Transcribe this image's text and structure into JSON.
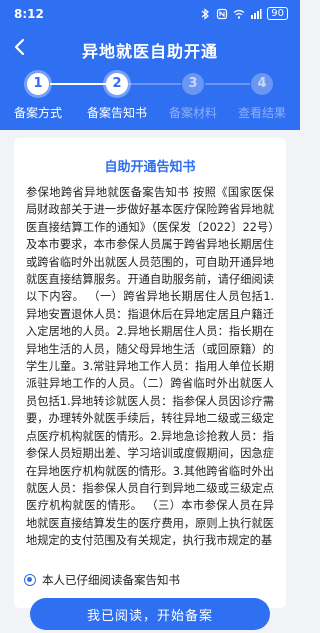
{
  "status": {
    "time": "8:12",
    "battery": "90"
  },
  "header": {
    "title": "异地就医自助开通"
  },
  "steps": [
    {
      "number": "1",
      "label": "备案方式",
      "state": "done"
    },
    {
      "number": "2",
      "label": "备案告知书",
      "state": "active"
    },
    {
      "number": "3",
      "label": "备案材料",
      "state": "inactive"
    },
    {
      "number": "4",
      "label": "查看结果",
      "state": "inactive"
    }
  ],
  "notice": {
    "title": "自助开通告知书",
    "body": "参保地跨省异地就医备案告知书 按照《国家医保局财政部关于进一步做好基本医疗保险跨省异地就医直接结算工作的通知》（医保发〔2022〕22号）及本市要求，本市参保人员属于跨省异地长期居住或跨省临时外出就医人员范围的，可自助开通异地就医直接结算服务。开通自助服务前，请仔细阅读以下内容。 （一）跨省异地长期居住人员包括1.异地安置退休人员：指退休后在异地定居且户籍迁入定居地的人员。2.异地长期居住人员：指长期在异地生活的人员，随父母异地生活（或回原籍）的学生儿童。3.常驻异地工作人员：指用人单位长期派驻异地工作的人员。（二）跨省临时外出就医人员包括1.异地转诊就医人员：指参保人员因诊疗需要，办理转外就医手续后，转往异地二级或三级定点医疗机构就医的情形。2.异地急诊抢救人员：指参保人员短期出差、学习培训或度假期间，因急症在异地医疗机构就医的情形。3.其他跨省临时外出就医人员：指参保人员自行到异地二级或三级定点医疗机构就医的情形。 （三）本市参保人员在异地就医直接结算发生的医疗费用，原则上执行就医地规定的支付范围及有关规定，执行我市规定的基"
  },
  "agreement": {
    "label": "本人已仔细阅读备案告知书"
  },
  "actions": {
    "primary_label": "我已阅读，开始备案"
  },
  "colors": {
    "primary": "#2f6ff2",
    "background": "#f1f3f7"
  }
}
